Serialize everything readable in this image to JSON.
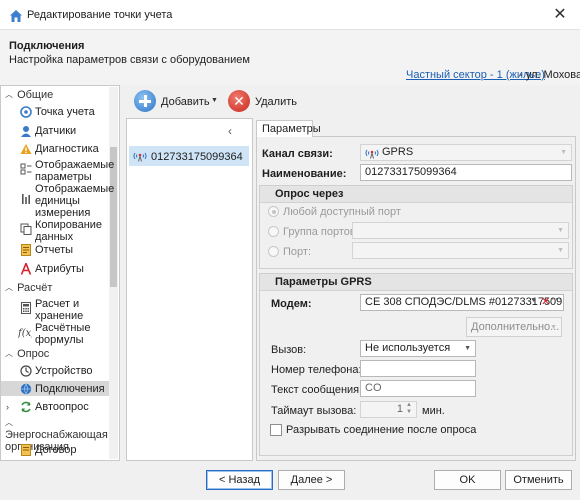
{
  "window": {
    "title": "Редактирование точки учета",
    "close_icon": "close-icon"
  },
  "header": {
    "title": "Подключения",
    "subtitle": "Настройка параметров связи с оборудованием",
    "link_text": "Частный сектор - 1 (жилье)",
    "street_text": "- ул. Моховая"
  },
  "sidebar": {
    "sections": [
      {
        "label": "Общие"
      },
      {
        "label": "Расчёт"
      },
      {
        "label": "Опрос"
      },
      {
        "label": "Энергоснабжающая организация"
      }
    ],
    "items": [
      {
        "label": "Точка учета",
        "icon": "meter-point-icon"
      },
      {
        "label": "Датчики",
        "icon": "sensor-icon"
      },
      {
        "label": "Диагностика",
        "icon": "warning-icon"
      },
      {
        "label": "Отображаемые параметры",
        "icon": "params-icon"
      },
      {
        "label": "Отображаемые единицы измерения",
        "icon": "units-icon"
      },
      {
        "label": "Копирование данных",
        "icon": "copy-icon"
      },
      {
        "label": "Отчеты",
        "icon": "report-icon"
      },
      {
        "label": "Атрибуты",
        "icon": "attribute-icon"
      },
      {
        "label": "Расчет и хранение",
        "icon": "calculator-icon"
      },
      {
        "label": "Расчётные формулы",
        "icon": "formula-icon"
      },
      {
        "label": "Устройство",
        "icon": "device-icon"
      },
      {
        "label": "Подключения",
        "icon": "connection-icon"
      },
      {
        "label": "Автоопрос",
        "icon": "autopoll-icon"
      },
      {
        "label": "Договор",
        "icon": "contract-icon"
      }
    ]
  },
  "toolbar": {
    "add_label": "Добавить",
    "delete_label": "Удалить"
  },
  "device_list": {
    "items": [
      "012733175099364"
    ]
  },
  "tabs": [
    "Параметры"
  ],
  "params": {
    "channel_label": "Канал связи:",
    "channel_value": "GPRS",
    "name_label": "Наименование:",
    "name_value": "012733175099364",
    "poll_group_title": "Опрос через",
    "poll_options": [
      "Любой доступный порт",
      "Группа портов:",
      "Порт:"
    ],
    "gprs_group_title": "Параметры GPRS",
    "modem_label": "Модем:",
    "modem_value": "CE 308 СПОДЭС/DLMS #01273317509...",
    "additional_button": "Дополнительно...",
    "call_label": "Вызов:",
    "call_value": "Не используется",
    "phone_label": "Номер телефона:",
    "phone_value": "",
    "message_label": "Текст сообщения:",
    "message_value": "CO",
    "timeout_label": "Таймаут вызова:",
    "timeout_value": "1",
    "timeout_unit": "мин.",
    "disconnect_label": "Разрывать соединение после опроса"
  },
  "footer": {
    "back": "< Назад",
    "next": "Далее >",
    "ok": "OK",
    "cancel": "Отменить"
  },
  "colors": {
    "link": "#1a5fb4",
    "selected_list": "#cfe4f6",
    "add_icon": "#2a73c8",
    "delete_icon": "#c8281c"
  }
}
